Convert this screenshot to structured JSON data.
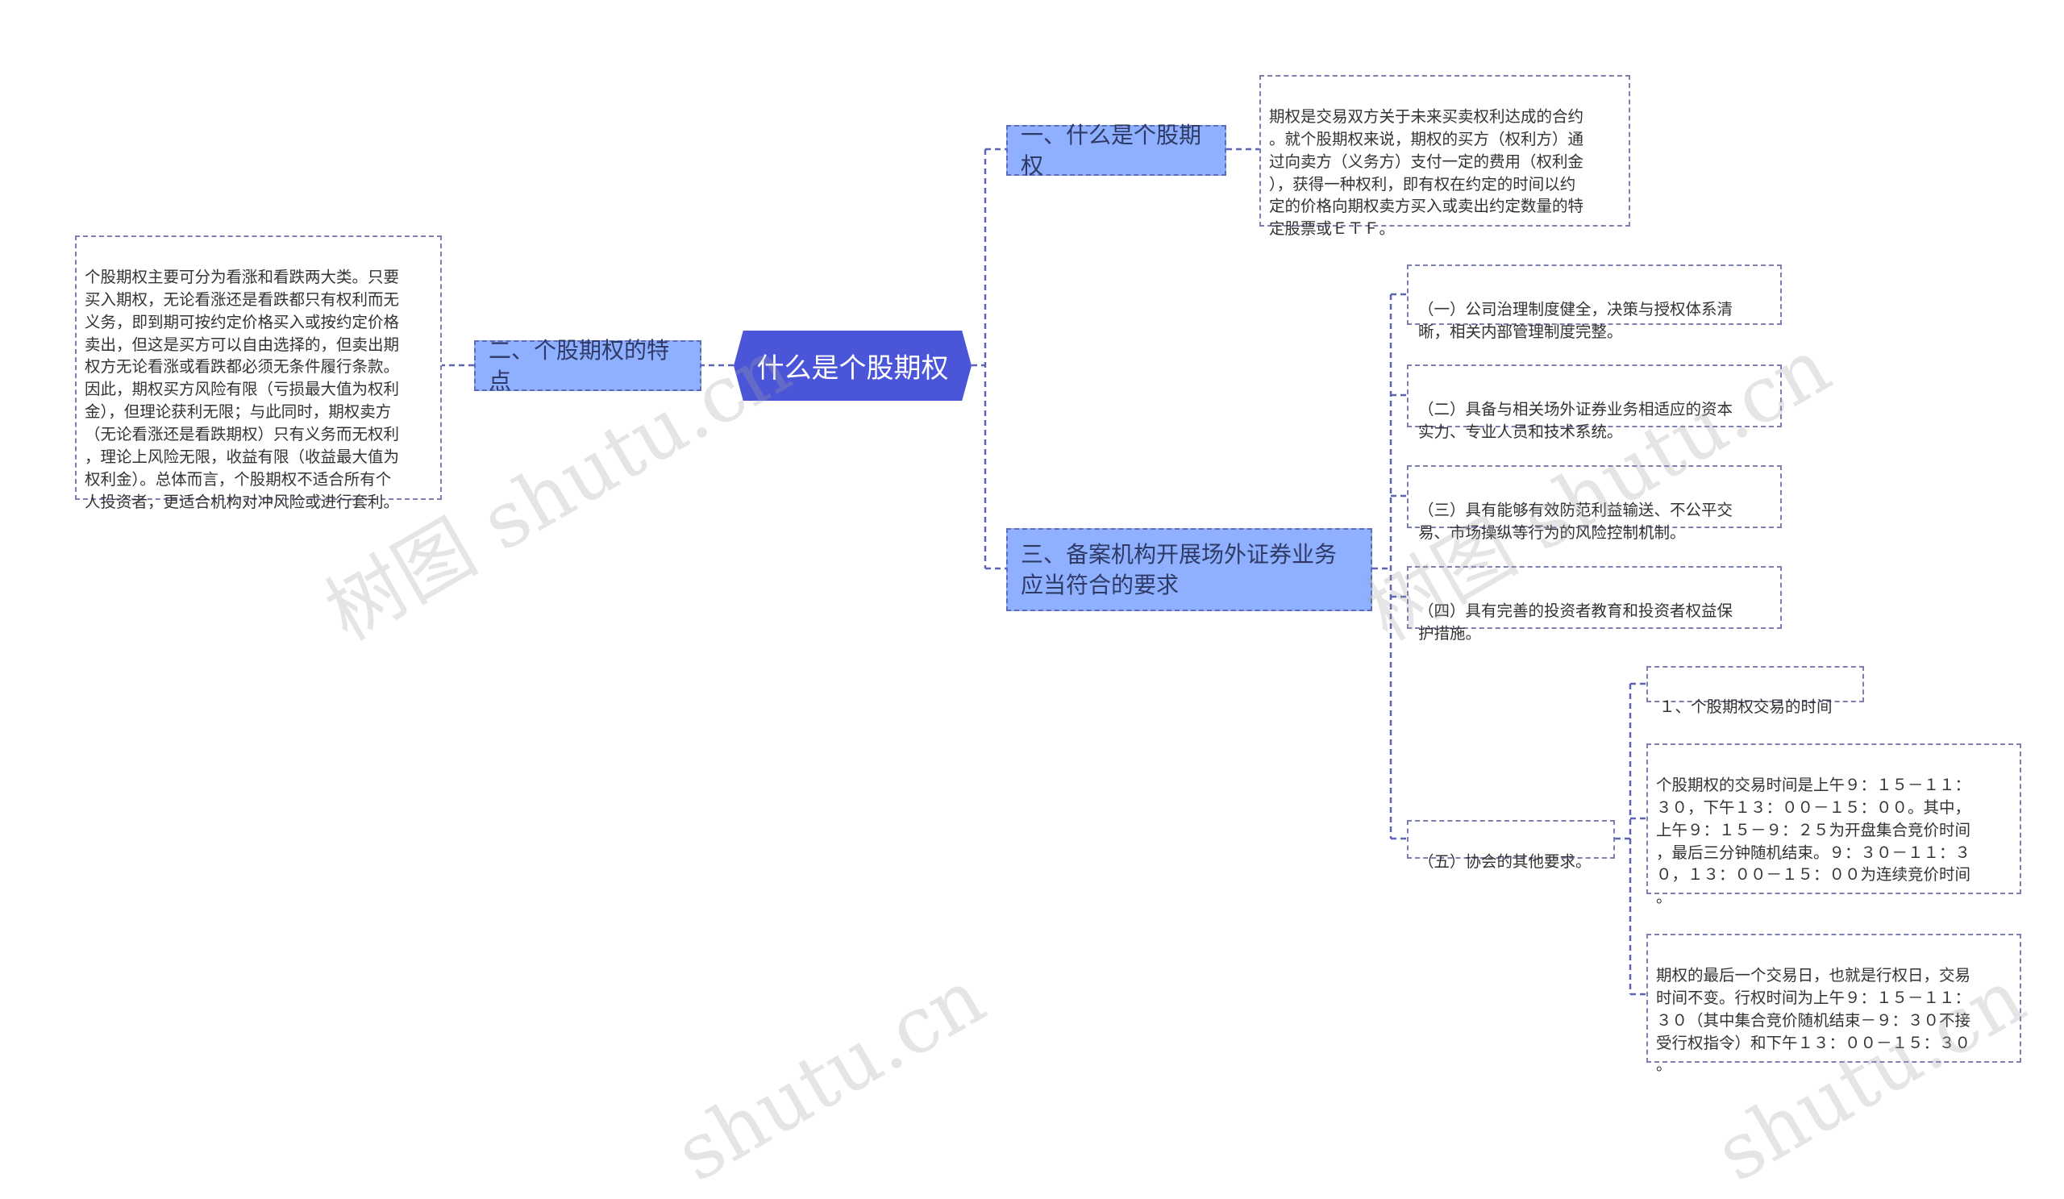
{
  "root": {
    "label": "什么是个股期权"
  },
  "branches": {
    "b1": {
      "label": "一、什么是个股期权"
    },
    "b2": {
      "label": "二、个股期权的特点"
    },
    "b3": {
      "label": "三、备案机构开展场外证券业务应当符合的要求"
    }
  },
  "leaves": {
    "b1_def": "期权是交易双方关于未来买卖权利达成的合约\n。就个股期权来说，期权的买方（权利方）通\n过向卖方（义务方）支付一定的费用（权利金\n），获得一种权利，即有权在约定的时间以约\n定的价格向期权卖方买入或卖出约定数量的特\n定股票或ＥＴＦ。",
    "b2_feat": "个股期权主要可分为看涨和看跌两大类。只要\n买入期权，无论看涨还是看跌都只有权利而无\n义务，即到期可按约定价格买入或按约定价格\n卖出，但这是买方可以自由选择的，但卖出期\n权方无论看涨或看跌都必须无条件履行条款。\n因此，期权买方风险有限（亏损最大值为权利\n金），但理论获利无限；与此同时，期权卖方\n（无论看涨还是看跌期权）只有义务而无权利\n，理论上风险无限，收益有限（收益最大值为\n权利金）。总体而言，个股期权不适合所有个\n人投资者，更适合机构对冲风险或进行套利。",
    "b3_1": "（一）公司治理制度健全，决策与授权体系清\n晰，相关内部管理制度完整。",
    "b3_2": "（二）具备与相关场外证券业务相适应的资本\n实力、专业人员和技术系统。",
    "b3_3": "（三）具有能够有效防范利益输送、不公平交\n易、市场操纵等行为的风险控制机制。",
    "b3_4": "（四）具有完善的投资者教育和投资者权益保\n护措施。",
    "b3_5": "（五）协会的其他要求。",
    "b3_5_title": "１、个股期权交易的时间",
    "b3_5_time": "个股期权的交易时间是上午９：１５－１１：\n３０，下午１３：００－１５：００。其中，\n上午９：１５－９：２５为开盘集合竞价时间\n，最后三分钟随机结束。９：３０－１１：３\n０，１３：００－１５：００为连续竞价时间\n。",
    "b3_5_last": "期权的最后一个交易日，也就是行权日，交易\n时间不变。行权时间为上午９：１５－１１：\n３０（其中集合竞价随机结束－９：３０不接\n受行权指令）和下午１３：００－１５：３０\n。"
  },
  "watermarks": [
    "树图 shutu.cn",
    "树图 shutu.cn",
    "shutu.cn",
    "shutu.cn"
  ],
  "colors": {
    "root_fill": "#4b55d7",
    "branch_fill": "#8fb0ff",
    "edge": "#5d63b5"
  }
}
